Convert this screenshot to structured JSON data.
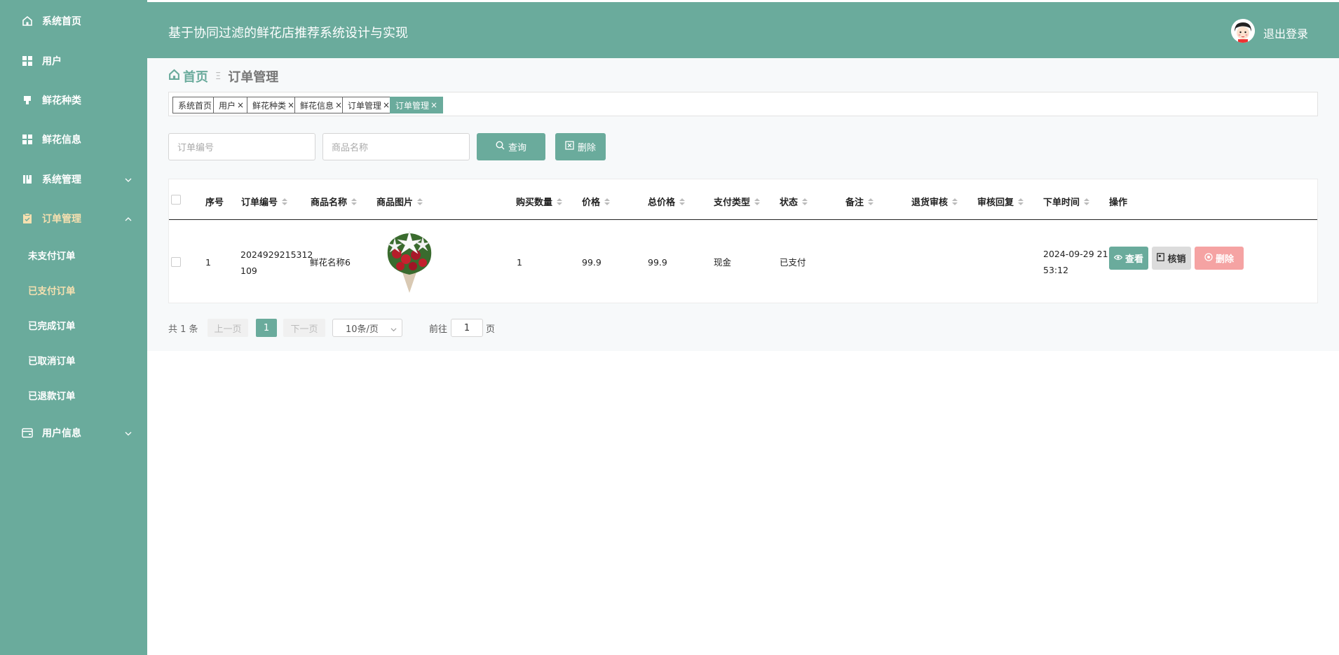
{
  "header": {
    "title": "基于协同过滤的鲜花店推荐系统设计与实现",
    "logout": "退出登录"
  },
  "sidebar": {
    "items": [
      {
        "label": "系统首页",
        "icon": "home-icon"
      },
      {
        "label": "用户",
        "icon": "grid-icon"
      },
      {
        "label": "鲜花种类",
        "icon": "flag-icon"
      },
      {
        "label": "鲜花信息",
        "icon": "grid-icon"
      },
      {
        "label": "系统管理",
        "icon": "book-icon"
      },
      {
        "label": "订单管理",
        "icon": "clipboard-icon"
      },
      {
        "label": "用户信息",
        "icon": "wallet-icon"
      }
    ],
    "submenu": [
      "未支付订单",
      "已支付订单",
      "已完成订单",
      "已取消订单",
      "已退款订单"
    ]
  },
  "breadcrumb": {
    "home": "首页",
    "sep": "Ξ",
    "current": "订单管理"
  },
  "tags": [
    "系统首页",
    "用户",
    "鲜花种类",
    "鲜花信息",
    "订单管理",
    "订单管理"
  ],
  "search": {
    "order_no_placeholder": "订单编号",
    "product_placeholder": "商品名称",
    "query_label": "查询",
    "delete_label": "删除"
  },
  "table": {
    "headers": [
      "序号",
      "订单编号",
      "商品名称",
      "商品图片",
      "购买数量",
      "价格",
      "总价格",
      "支付类型",
      "状态",
      "备注",
      "退货审核",
      "审核回复",
      "下单时间",
      "操作"
    ],
    "rows": [
      {
        "index": "1",
        "order_no_line1": "2024929215312",
        "order_no_line2": "109",
        "product": "鲜花名称6",
        "quantity": "1",
        "price": "99.9",
        "total": "99.9",
        "pay_type": "现金",
        "status": "已支付",
        "note": "",
        "return_review": "",
        "review_reply": "",
        "time_line1": "2024-09-29 21:",
        "time_line2": "53:12"
      }
    ],
    "actions": {
      "view": "查看",
      "verify": "核销",
      "delete": "删除"
    }
  },
  "pagination": {
    "total": "共 1 条",
    "prev": "上一页",
    "page": "1",
    "next": "下一页",
    "page_size": "10条/页",
    "goto": "前往",
    "goto_value": "1",
    "page_unit": "页"
  },
  "colors": {
    "primary": "#6aab9c",
    "danger": "#f5a3a3",
    "active_menu": "#f6e0b0"
  }
}
